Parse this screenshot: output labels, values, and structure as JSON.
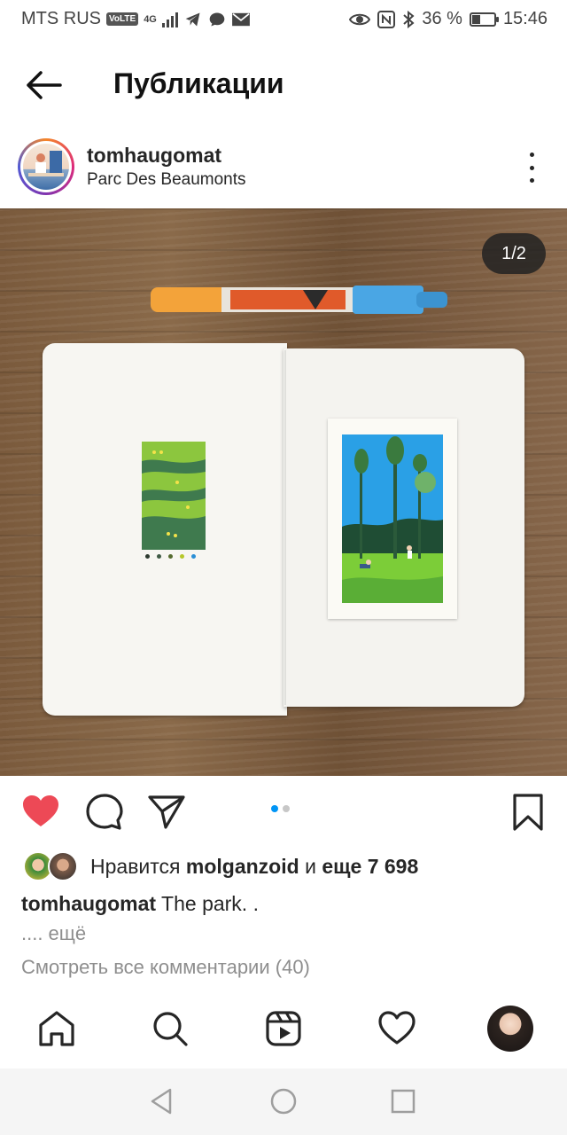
{
  "status_bar": {
    "carrier": "MTS RUS",
    "volte": "VoLTE",
    "network": "4G",
    "battery_percent": "36 %",
    "battery_level": 0.36,
    "time": "15:46"
  },
  "header": {
    "title": "Публикации"
  },
  "post": {
    "username": "tomhaugomat",
    "location": "Parc Des Beaumonts",
    "image_counter": "1/2",
    "current_image": 1,
    "total_images": 2,
    "liked": true,
    "likes_prefix": "Нравится",
    "liked_by": "molganzoid",
    "likes_connector": "и",
    "likes_more": "еще 7 698",
    "caption_user": "tomhaugomat",
    "caption_text": "The park. .",
    "caption_more": ".... ещё",
    "view_comments": "Смотреть все комментарии (40)"
  },
  "colors": {
    "like_red": "#ed4956",
    "pager_active": "#0095f6",
    "pager_inactive": "#c7c7c7",
    "text_primary": "#262626",
    "text_secondary": "#8e8e8e"
  },
  "icons": {
    "back": "arrow-left-icon",
    "more": "more-vertical-icon",
    "like": "heart-filled-icon",
    "comment": "comment-icon",
    "share": "send-icon",
    "save": "bookmark-icon",
    "home": "home-icon",
    "search": "search-icon",
    "reels": "reels-icon",
    "activity": "heart-outline-icon",
    "profile": "profile-avatar"
  }
}
